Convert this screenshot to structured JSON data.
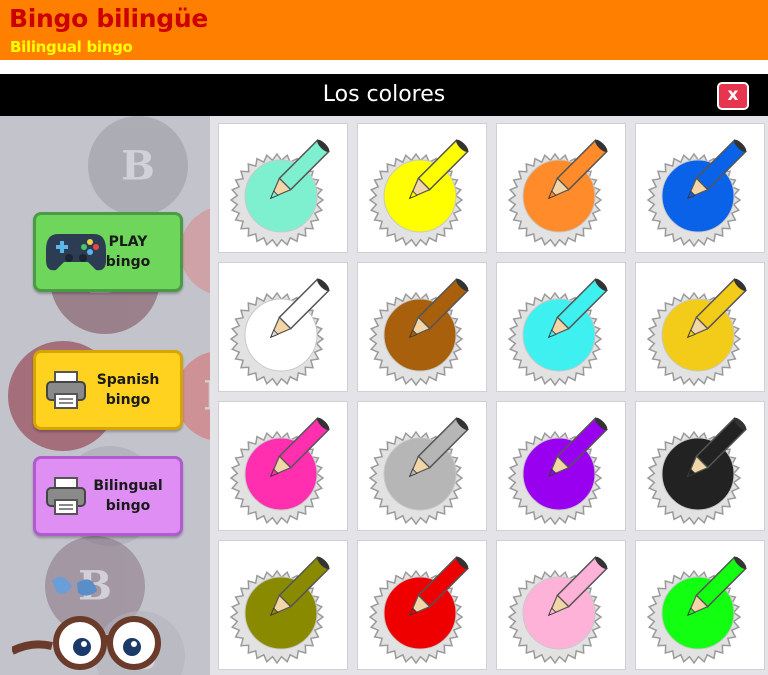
{
  "header": {
    "title": "Bingo bilingüe",
    "subtitle": "Bilingual bingo"
  },
  "window": {
    "title": "Los colores",
    "close_label": "x"
  },
  "menu": {
    "play": {
      "line1": "PLAY",
      "line2": "bingo",
      "icon": "gamepad-icon",
      "color": "#6ed65a"
    },
    "spanish": {
      "line1": "Spanish",
      "line2": "bingo",
      "icon": "printer-icon",
      "color": "#ffd21f"
    },
    "bilingual": {
      "line1": "Bilingual",
      "line2": "bingo",
      "icon": "printer-icon",
      "color": "#df8ff3"
    }
  },
  "colors": {
    "banner": "#ff8000",
    "title_text": "#cc0000",
    "subtitle_text": "#ffff00",
    "close_button": "#e8354f"
  },
  "cards": [
    {
      "name": "aquamarine",
      "color": "#7ef0cf"
    },
    {
      "name": "yellow",
      "color": "#ffff00"
    },
    {
      "name": "orange",
      "color": "#ff8b2a"
    },
    {
      "name": "blue",
      "color": "#0a62e8"
    },
    {
      "name": "white",
      "color": "#ffffff"
    },
    {
      "name": "brown",
      "color": "#a8600c"
    },
    {
      "name": "cyan",
      "color": "#3ef0f0"
    },
    {
      "name": "gold",
      "color": "#f2cc18"
    },
    {
      "name": "pink",
      "color": "#ff2fb0"
    },
    {
      "name": "gray",
      "color": "#b6b6b6"
    },
    {
      "name": "purple",
      "color": "#9a00f0"
    },
    {
      "name": "black",
      "color": "#222222"
    },
    {
      "name": "olive",
      "color": "#8a8a00"
    },
    {
      "name": "red",
      "color": "#ee0000"
    },
    {
      "name": "light-pink",
      "color": "#ffb2d8"
    },
    {
      "name": "green",
      "color": "#12ff12"
    }
  ]
}
